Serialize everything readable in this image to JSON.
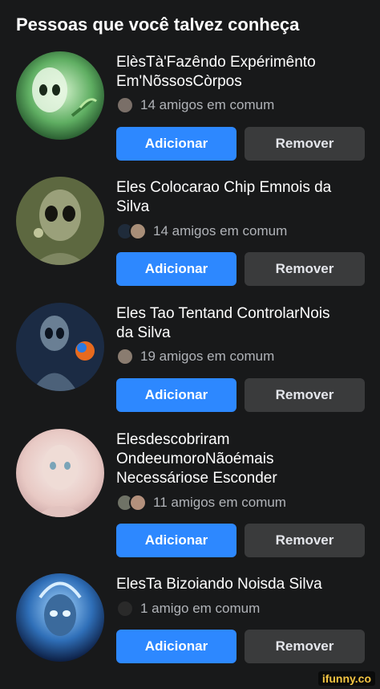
{
  "header": {
    "title": "Pessoas que você talvez conheça"
  },
  "suggestions": [
    {
      "name_lines": [
        "ElèsTà'Fazêndo Expérimênto",
        "Em'NõssosCòrpos"
      ],
      "mutual": "14 amigos em comum",
      "add_label": "Adicionar",
      "remove_label": "Remover"
    },
    {
      "name_lines": [
        "Eles Colocarao Chip Emnois da",
        "Silva"
      ],
      "mutual": "14 amigos em comum",
      "add_label": "Adicionar",
      "remove_label": "Remover"
    },
    {
      "name_lines": [
        "Eles Tao Tentand ControlarNois",
        "da Silva"
      ],
      "mutual": "19 amigos em comum",
      "add_label": "Adicionar",
      "remove_label": "Remover"
    },
    {
      "name_lines": [
        "Elesdescobriram",
        "OndeeumoroNãoémais",
        "Necessáriose Esconder"
      ],
      "mutual": "11 amigos em comum",
      "add_label": "Adicionar",
      "remove_label": "Remover"
    },
    {
      "name_lines": [
        "ElesTa Bizoiando Noisda Silva"
      ],
      "mutual": "1 amigo em comum",
      "add_label": "Adicionar",
      "remove_label": "Remover"
    }
  ],
  "watermark": "ifunny.co",
  "colors": {
    "background": "#18191a",
    "add_button": "#2d88ff",
    "remove_button": "#3a3b3c",
    "muted_text": "#b0b3b8"
  }
}
